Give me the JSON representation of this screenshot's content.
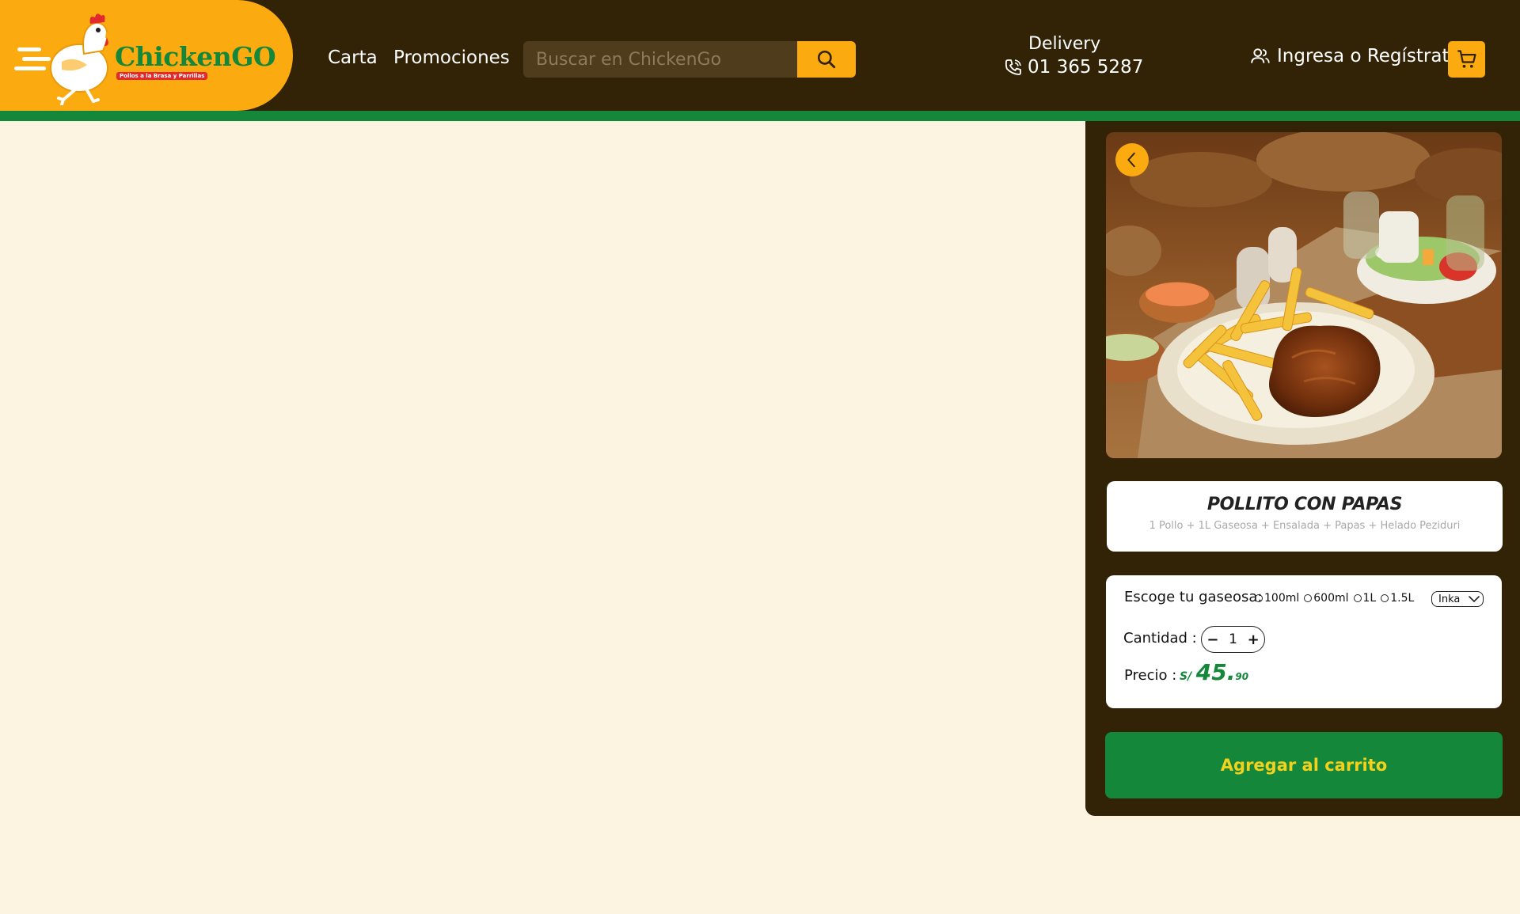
{
  "brand": {
    "name": "ChickenGO",
    "tagline": "Pollos a la Brasa y Parrillas"
  },
  "nav": {
    "items": [
      {
        "label": "Carta"
      },
      {
        "label": "Promociones"
      }
    ]
  },
  "search": {
    "placeholder": "Buscar en ChickenGo",
    "value": ""
  },
  "delivery": {
    "title": "Delivery",
    "phone": "01 365 5287"
  },
  "account": {
    "login_label": "Ingresa o Regístrate"
  },
  "icons": {
    "search": "search-icon",
    "phone": "phone-icon",
    "user": "user-icon",
    "cart": "cart-icon",
    "prev": "chevron-left-icon",
    "dropdown": "chevron-down-icon"
  },
  "product": {
    "name": "POLLITO CON PAPAS",
    "description": "1 Pollo  + 1L Gaseosa + Ensalada + Papas + Helado Peziduri",
    "soda": {
      "label": "Escoge tu gaseosa:",
      "sizes": [
        "100ml",
        "600ml",
        "1L",
        "1.5L"
      ],
      "brand_selected": "Inka"
    },
    "quantity": {
      "label": "Cantidad :",
      "value": "1",
      "minus": "−",
      "plus": "+"
    },
    "price": {
      "label": "Precio :",
      "currency": "S/",
      "integer": "45.",
      "decimal": "90"
    },
    "add_to_cart_label": "Agregar al carrito"
  },
  "colors": {
    "header_bg": "#332306",
    "accent_orange": "#fbaa10",
    "brand_green": "#14873a",
    "page_bg": "#fdf3e1",
    "button_text_yellow": "#f4d11b"
  }
}
